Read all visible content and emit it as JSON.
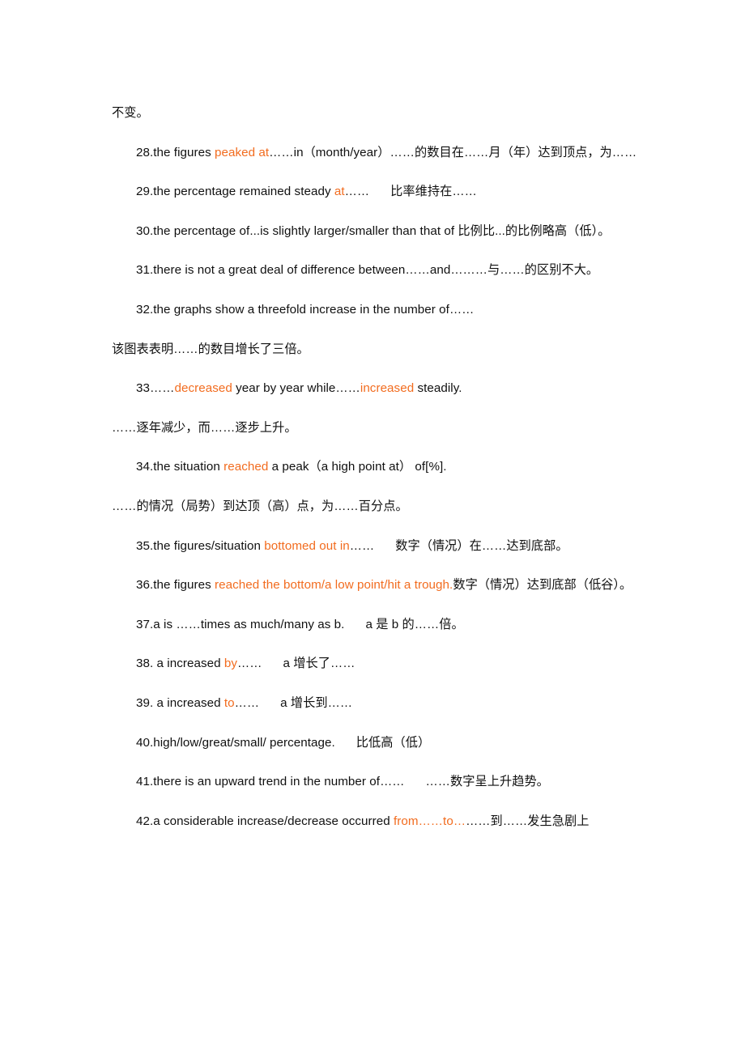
{
  "document": {
    "page_background": "#ffffff",
    "text_color": "#101010",
    "highlight_color": "#F26C1F",
    "lines": [
      {
        "id": "line-continuation-27",
        "indent": false,
        "segments": [
          {
            "text": "不变。",
            "highlight": false
          }
        ]
      },
      {
        "id": "line-28",
        "indent": true,
        "segments": [
          {
            "text": "28.the figures ",
            "highlight": false
          },
          {
            "text": "peaked at",
            "highlight": true
          },
          {
            "text": "……in（month/year）……的数目在……月（年）达到顶点，为……",
            "highlight": false
          }
        ]
      },
      {
        "id": "line-29",
        "indent": true,
        "segments": [
          {
            "text": "29.the percentage ",
            "highlight": false
          },
          {
            "text": "remained",
            "highlight": false
          },
          {
            "text": " steady ",
            "highlight": false
          },
          {
            "text": "at",
            "highlight": true
          },
          {
            "text": "……",
            "highlight": false
          },
          {
            "text": "SPACER",
            "highlight": false
          },
          {
            "text": "比率维持在……",
            "highlight": false
          }
        ]
      },
      {
        "id": "line-30",
        "indent": true,
        "segments": [
          {
            "text": "30.the percentage of...is slightly larger/smaller than that of 比例比...的比例略高（低）。",
            "highlight": false
          }
        ]
      },
      {
        "id": "line-31",
        "indent": true,
        "segments": [
          {
            "text": "31.there is not a great deal of difference between……and………与……的区别不大。",
            "highlight": false
          }
        ]
      },
      {
        "id": "line-32",
        "indent": true,
        "segments": [
          {
            "text": "32.the graphs show a threefold increase in the number of……",
            "highlight": false
          }
        ]
      },
      {
        "id": "line-32-cn",
        "indent": false,
        "segments": [
          {
            "text": "该图表表明……的数目增长了三倍。",
            "highlight": false
          }
        ]
      },
      {
        "id": "line-33",
        "indent": true,
        "segments": [
          {
            "text": "33……",
            "highlight": false
          },
          {
            "text": "decreased",
            "highlight": true
          },
          {
            "text": " year by year while……",
            "highlight": false
          },
          {
            "text": "increased",
            "highlight": true
          },
          {
            "text": " steadily.",
            "highlight": false
          }
        ]
      },
      {
        "id": "line-33-cn",
        "indent": false,
        "segments": [
          {
            "text": "……逐年减少，而……逐步上升。",
            "highlight": false
          }
        ]
      },
      {
        "id": "line-34",
        "indent": true,
        "segments": [
          {
            "text": "34.the situation ",
            "highlight": false
          },
          {
            "text": "reached",
            "highlight": true
          },
          {
            "text": " a peak（a high point at）  of[%].",
            "highlight": false
          }
        ]
      },
      {
        "id": "line-34-cn",
        "indent": false,
        "segments": [
          {
            "text": "……的情况（局势）到达顶（高）点，为……百分点。",
            "highlight": false
          }
        ]
      },
      {
        "id": "line-35",
        "indent": true,
        "segments": [
          {
            "text": "35.the figures/situation ",
            "highlight": false
          },
          {
            "text": "bottomed out in",
            "highlight": true
          },
          {
            "text": "……",
            "highlight": false
          },
          {
            "text": "SPACER",
            "highlight": false
          },
          {
            "text": "数字（情况）在……达到底部。",
            "highlight": false
          }
        ]
      },
      {
        "id": "line-36",
        "indent": true,
        "segments": [
          {
            "text": "36.the figures ",
            "highlight": false
          },
          {
            "text": "reached the bottom/a low point/hit a trough.",
            "highlight": true
          },
          {
            "text": "数字（情况）达到底部（低谷）。",
            "highlight": false
          }
        ]
      },
      {
        "id": "line-37",
        "indent": true,
        "segments": [
          {
            "text": "37.a is  ……times as much/many as b.",
            "highlight": false
          },
          {
            "text": "SPACER",
            "highlight": false
          },
          {
            "text": "a 是 b 的……倍。",
            "highlight": false
          }
        ]
      },
      {
        "id": "line-38",
        "indent": true,
        "segments": [
          {
            "text": "38. a increased ",
            "highlight": false
          },
          {
            "text": "by",
            "highlight": true
          },
          {
            "text": "……",
            "highlight": false
          },
          {
            "text": "SPACER",
            "highlight": false
          },
          {
            "text": "a 增长了……",
            "highlight": false
          }
        ]
      },
      {
        "id": "line-39",
        "indent": true,
        "segments": [
          {
            "text": "39. a increased ",
            "highlight": false
          },
          {
            "text": "to",
            "highlight": true
          },
          {
            "text": "……",
            "highlight": false
          },
          {
            "text": "SPACER",
            "highlight": false
          },
          {
            "text": "a 增长到……",
            "highlight": false
          }
        ]
      },
      {
        "id": "line-40",
        "indent": true,
        "segments": [
          {
            "text": "40.high/low/great/small/ percentage.",
            "highlight": false
          },
          {
            "text": "SPACER",
            "highlight": false
          },
          {
            "text": "比低高（低）",
            "highlight": false
          }
        ]
      },
      {
        "id": "line-41",
        "indent": true,
        "segments": [
          {
            "text": "41.there is an upward trend in the number of……",
            "highlight": false
          },
          {
            "text": "SPACER",
            "highlight": false
          },
          {
            "text": "……数字呈上升趋势。",
            "highlight": false
          }
        ]
      },
      {
        "id": "line-42",
        "indent": true,
        "segments": [
          {
            "text": "42.a considerable increase/decrease occurred ",
            "highlight": false
          },
          {
            "text": "from……to…",
            "highlight": true
          },
          {
            "text": "……到……发生急剧上",
            "highlight": false
          }
        ]
      }
    ]
  }
}
